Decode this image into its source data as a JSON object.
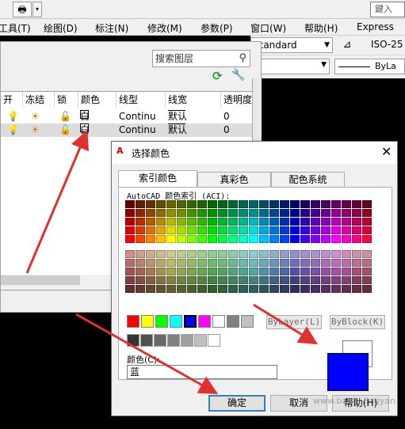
{
  "toolbar": {
    "print_glyph": "🖶",
    "dropdown_glyph": "▾",
    "search_partial": "鍵入",
    "overflow_glyph": "▶"
  },
  "menu": {
    "items": [
      "工具(T)",
      "绘图(D)",
      "标注(N)",
      "修改(M)",
      "参数(P)",
      "窗口(W)",
      "帮助(H)",
      "Express"
    ]
  },
  "style_toolbar": {
    "text_style": "Standard",
    "dim_style": "ISO-25",
    "linetype": "ByLa"
  },
  "layer_panel": {
    "search_placeholder": "搜索图层",
    "columns": [
      "开",
      "冻结",
      "锁",
      "颜色",
      "线型",
      "线宽",
      "透明度"
    ],
    "rows": [
      {
        "color": "白",
        "linetype": "Continu",
        "lineweight": "默认",
        "transparency": "0",
        "selected": false
      },
      {
        "color": "白",
        "linetype": "Continu",
        "lineweight": "默认",
        "transparency": "0",
        "selected": true
      }
    ]
  },
  "color_dialog": {
    "title": "选择颜色",
    "close_glyph": "✕",
    "tabs": [
      "索引颜色",
      "真彩色",
      "配色系统"
    ],
    "aci_label": "AutoCAD 颜色索引 (ACI):",
    "bylayer_label": "ByLayer(L)",
    "byblock_label": "ByBlock(K)",
    "color_label": "颜色(C):",
    "color_value": "蓝",
    "ok_label": "确定",
    "cancel_label": "取消",
    "help_label": "帮助(H)",
    "standard_colors": [
      "#ff0000",
      "#ffff00",
      "#00ff00",
      "#00ffff",
      "#0000ff",
      "#ff00ff",
      "#ffffff",
      "#808080",
      "#c0c0c0"
    ],
    "gray_colors": [
      "#333333",
      "#505050",
      "#696969",
      "#808080",
      "#a0a0a0",
      "#c0c0c0",
      "#ffffff"
    ],
    "selected_color": "#0000ff",
    "previous_color": "#ffffff"
  },
  "watermark": "www.baidu.jingyan"
}
